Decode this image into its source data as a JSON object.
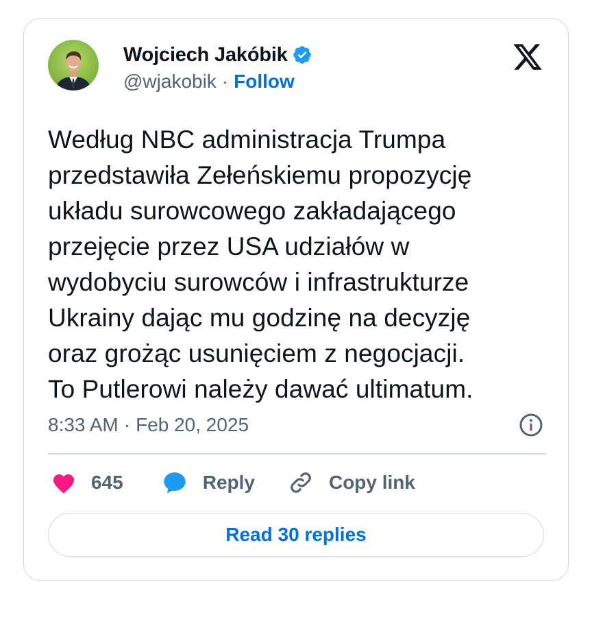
{
  "author": {
    "name": "Wojciech Jakóbik",
    "handle": "@wjakobik",
    "separator": "·",
    "follow_label": "Follow",
    "verified_color": "#1d9bf0"
  },
  "tweet": {
    "lines": [
      "Według NBC administracja Trumpa",
      "przedstawiła Zełeńskiemu propozycję",
      "układu surowcowego zakładającego",
      "przejęcie przez USA udziałów w",
      "wydobyciu surowców i infrastrukturze",
      "Ukrainy dając mu godzinę na decyzję",
      "oraz grożąc usunięciem z negocjacji.",
      "To Putlerowi należy dawać ultimatum."
    ],
    "time": "8:33 AM",
    "date_separator": "·",
    "date": "Feb 20, 2025"
  },
  "actions": {
    "like_count": "645",
    "reply_label": "Reply",
    "copy_link_label": "Copy link",
    "like_color": "#f91880",
    "reply_color": "#1d9bf0"
  },
  "replies": {
    "read_label": "Read 30 replies"
  },
  "icons": {
    "brand": "x-logo-icon",
    "verified": "verified-badge-icon",
    "info": "info-icon",
    "like": "heart-icon",
    "reply": "speech-bubble-icon",
    "copy": "link-icon"
  },
  "colors": {
    "link_blue": "#006fd6",
    "secondary_text": "#536471",
    "border": "#cfd9de"
  }
}
